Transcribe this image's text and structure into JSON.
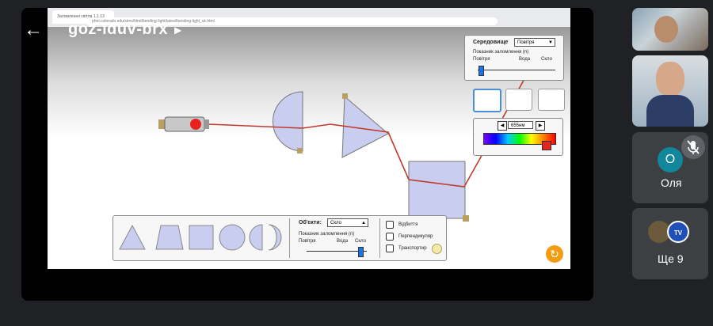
{
  "meeting": {
    "code": "goz-iduv-brx",
    "back_icon": "arrow-left-icon"
  },
  "browser": {
    "tab_title": "Заломлення світла 1.1.13",
    "url": "phet.colorado.edu/sims/html/bending-light/latest/bending-light_uk.html"
  },
  "simulation": {
    "environment_panel": {
      "label": "Середовище",
      "medium_value": "Повітря",
      "refraction_label": "Показник заломлення (n)",
      "scale": [
        "Повітря",
        "Вода",
        "Скло"
      ]
    },
    "wavelength": {
      "value": "655нм"
    },
    "objects_panel": {
      "label": "Об'єкти:",
      "material_value": "Скло",
      "refraction_label": "Показник заломлення (n)",
      "scale": [
        "Повітря",
        "Вода",
        "Скло"
      ]
    },
    "checkboxes": [
      "Відбиття",
      "Перпендикуляр",
      "Транспортир"
    ],
    "laser_color": "#e8231e",
    "beam_color": "#c0392b"
  },
  "participants": [
    {
      "name": "",
      "type": "video"
    },
    {
      "name": "",
      "type": "video"
    },
    {
      "name": "Оля",
      "initial": "О",
      "muted": true,
      "avatar_color": "#12869a"
    },
    {
      "name": "Ще 9",
      "type": "more"
    }
  ]
}
